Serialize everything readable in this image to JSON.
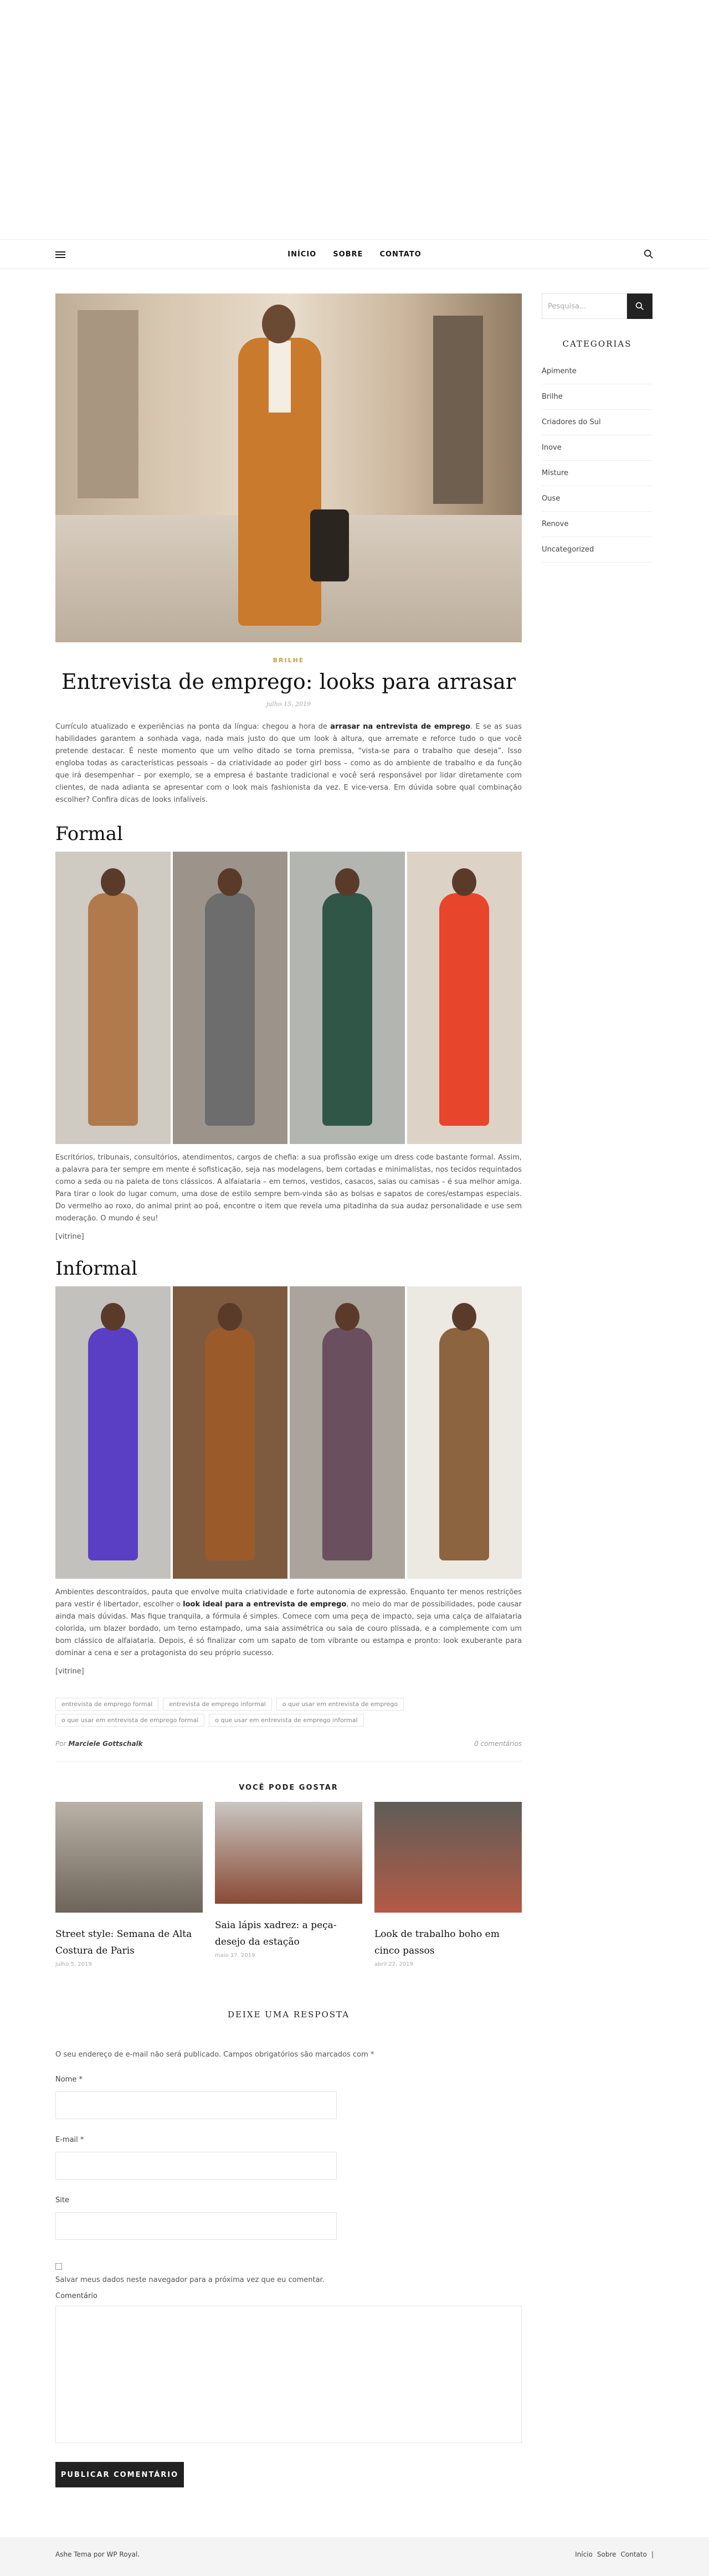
{
  "nav": {
    "links": [
      "INÍCIO",
      "SOBRE",
      "CONTATO"
    ]
  },
  "post": {
    "category": "BRILHE",
    "title": "Entrevista de emprego: looks para arrasar",
    "date": "julho 15, 2019",
    "intro_a": "Currículo atualizado e experiências na ponta da língua: chegou a hora de ",
    "intro_bold": "arrasar na entrevista de emprego",
    "intro_b": ". E se as suas habilidades garantem a sonhada vaga, nada mais justo do que um look à altura, que arremate e reforce tudo o que você pretende destacar. É neste momento que um velho ditado se torna premissa, “vista-se para o trabalho que deseja”. Isso engloba todas as características pessoais – da criatividade ao poder girl boss – como as do ambiente de trabalho e da função que irá desempenhar – por exemplo, se a empresa é bastante tradicional e você será responsável por lidar diretamente com clientes, de nada adianta se apresentar com o look mais fashionista da vez. E vice-versa. Em dúvida sobre qual combinação escolher? Confira dicas de looks infalíveis.",
    "formal_heading": "Formal",
    "formal_text": "Escritórios, tribunais, consultórios, atendimentos, cargos de chefia: a sua profissão exige um dress code bastante formal. Assim, a palavra para ter sempre em mente é sofisticação, seja nas modelagens, bem cortadas e minimalistas, nos tecidos requintados como a seda ou na paleta de tons clássicos. A alfaiataria – em ternos, vestidos, casacos, saias ou camisas – é sua melhor amiga. Para tirar o look do lugar comum, uma dose de estilo sempre bem-vinda são as bolsas e sapatos de cores/estampas especiais. Do vermelho ao roxo, do animal print ao poá, encontre o item que revela uma pitadinha da sua audaz personalidade e use sem moderação. O mundo é seu!",
    "vitrine1": "[vitrine]",
    "informal_heading": "Informal",
    "informal_a": "Ambientes descontraídos, pauta que envolve muita criatividade e forte autonomia de expressão. Enquanto ter menos restrições para vestir é libertador, escolher o ",
    "informal_bold": "look ideal para a entrevista de emprego",
    "informal_b": ", no meio do mar de possibilidades, pode causar ainda mais dúvidas. Mas fique tranquila, a fórmula é simples. Comece com uma peça de impacto, seja uma calça de alfaiataria colorida, um blazer bordado, um terno estampado, uma saia assimétrica ou saia de couro plissada, e a complemente com um bom clássico de alfaiataria. Depois, é só finalizar com um sapato de tom vibrante ou estampa e pronto: look exuberante para dominar a cena e ser a protagonista do seu próprio sucesso.",
    "vitrine2": "[vitrine]",
    "tags": [
      "entrevista de emprego formal",
      "entrevista de emprego informal",
      "o que usar em entrevista de emprego",
      "o que usar em entrevista de emprego formal",
      "o que usar em entrevista de emprego informal"
    ],
    "author_prefix": "Por",
    "author": "Marciele Gottschalk",
    "comments": "0 comentários"
  },
  "related": {
    "heading": "VOCÊ PODE GOSTAR",
    "items": [
      {
        "title": "Street style: Semana de Alta Costura de Paris",
        "date": "julho 5, 2019"
      },
      {
        "title": "Saia lápis xadrez: a peça-desejo da estação",
        "date": "maio 17, 2019"
      },
      {
        "title": "Look de trabalho boho em cinco passos",
        "date": "abril 22, 2019"
      }
    ]
  },
  "reply": {
    "heading": "DEIXE UMA RESPOSTA",
    "note": "O seu endereço de e-mail não será publicado. Campos obrigatórios são marcados com *",
    "name_label": "Nome *",
    "email_label": "E-mail *",
    "site_label": "Site",
    "save_label": "Salvar meus dados neste navegador para a próxima vez que eu comentar.",
    "comment_label": "Comentário",
    "submit": "PUBLICAR COMENTÁRIO"
  },
  "sidebar": {
    "search_placeholder": "Pesquisa...",
    "categories_heading": "CATEGORIAS",
    "categories": [
      "Apimente",
      "Brilhe",
      "Criadores do Sul",
      "Inove",
      "Misture",
      "Ouse",
      "Renove",
      "Uncategorized"
    ]
  },
  "footer": {
    "left": "Ashe Tema por WP Royal.",
    "links": [
      "Início",
      "Sobre",
      "Contato"
    ],
    "separator": "|"
  }
}
